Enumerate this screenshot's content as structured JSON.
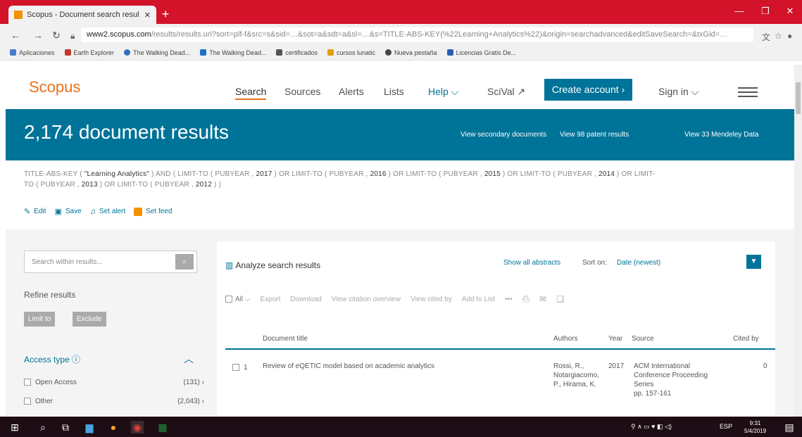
{
  "browser": {
    "tab_title": "Scopus - Document search resul",
    "url_host": "www2.scopus.com",
    "url_path": "/results/results.uri?sort=plf-f&src=s&sid=…&sot=a&sdt=a&sl=…&s=TITLE-ABS-KEY(%22Learning+Analytics%22)&origin=searchadvanced&editSaveSearch=&txGid=…",
    "bookmarks": [
      {
        "label": "Aplicaciones",
        "color": "#4a7bd0"
      },
      {
        "label": "Earth Explorer",
        "color": "#c0392b"
      },
      {
        "label": "The Walking Dead...",
        "color": "#2f6fbd"
      },
      {
        "label": "The Walking Dead...",
        "color": "#1a73c8"
      },
      {
        "label": "certificados",
        "color": "#555555"
      },
      {
        "label": "cursos lunatic",
        "color": "#e0a000"
      },
      {
        "label": "Nueva pestaña",
        "color": "#444444"
      },
      {
        "label": "Licencias Gratis De...",
        "color": "#2b5fb3"
      }
    ]
  },
  "nav": {
    "logo": "Scopus",
    "search": "Search",
    "sources": "Sources",
    "alerts": "Alerts",
    "lists": "Lists",
    "help": "Help ⌵",
    "scival": "SciVal ↗",
    "create_account": "Create account ›",
    "sign_in": "Sign in ⌵"
  },
  "banner": {
    "count": "2,174 document results",
    "secondary": "View secondary documents",
    "patent": "View 98 patent results",
    "mendeley": "View 33 Mendeley Data"
  },
  "query": {
    "line1_a": "TITLE-ABS-KEY ( ",
    "line1_term": "\"Learning Analytics\"",
    "line1_b": " )  AND  ( LIMIT-TO ( PUBYEAR ,  ",
    "y2017": "2017",
    "line1_c": " )  OR  LIMIT-TO ( PUBYEAR ,  ",
    "y2016": "2016",
    "y2015": "2015",
    "y2014": "2014",
    "line1_d": " )  OR  LIMIT-",
    "line2_a": "TO ( PUBYEAR ,  ",
    "y2013": "2013",
    "line2_b": " )  OR  LIMIT-TO ( PUBYEAR ,  ",
    "y2012": "2012",
    "line2_c": " ) )"
  },
  "actions": {
    "edit": "Edit",
    "save": "Save",
    "set_alert": "Set alert",
    "set_feed": "Set feed"
  },
  "sidebar": {
    "search_placeholder": "Search within results...",
    "refine": "Refine results",
    "limit_to": "Limit to",
    "exclude": "Exclude",
    "access_type": "Access type",
    "facets": [
      {
        "label": "Open Access",
        "count": "(131)  ›"
      },
      {
        "label": "Other",
        "count": "(2,043)  ›"
      }
    ]
  },
  "results": {
    "analyze": "Analyze search results",
    "show_abstracts": "Show all abstracts",
    "sort_label": "Sort on:",
    "sort_value": "Date (newest)",
    "toolbar": {
      "all": "All ⌵",
      "export": "Export",
      "download": "Download",
      "citation": "View citation overview",
      "cited_by": "View cited by",
      "add_to_list": "Add to List",
      "more": "•••"
    },
    "columns": {
      "title": "Document title",
      "authors": "Authors",
      "year": "Year",
      "source": "Source",
      "cited_by": "Cited by"
    },
    "rows": [
      {
        "num": "1",
        "title": "Review of eQETIC model based on academic analytics",
        "authors_1": "Rossi, R.,",
        "authors_2": "Notargiacomo,",
        "authors_3": "P., Hirama, K.",
        "year": "2017",
        "source_1": "ACM International",
        "source_2": "Conference Proceeding",
        "source_3": "Series",
        "source_4": "pp. 157-161",
        "cited": "0"
      }
    ]
  },
  "taskbar": {
    "lang": "ESP",
    "time": "9:31",
    "date": "5/4/2019"
  }
}
